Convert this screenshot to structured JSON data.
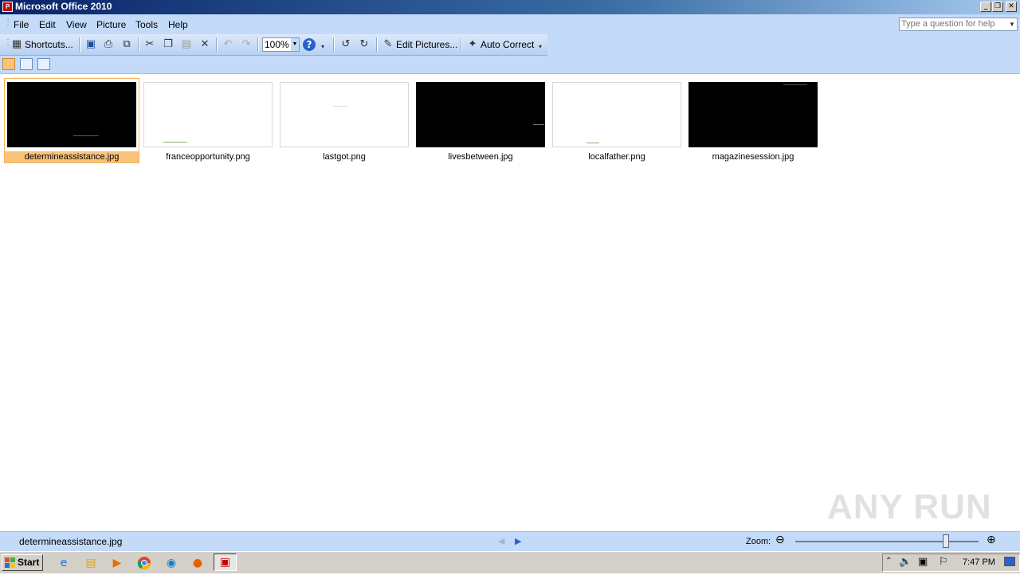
{
  "window": {
    "title": "Microsoft Office 2010",
    "controls": {
      "minimize": "_",
      "restore": "❐",
      "close": "✕"
    }
  },
  "menu": {
    "items": [
      "File",
      "Edit",
      "View",
      "Picture",
      "Tools",
      "Help"
    ],
    "help_placeholder": "Type a question for help"
  },
  "toolbar": {
    "shortcuts_label": "Shortcuts...",
    "zoom_value": "100%",
    "edit_pictures_label": "Edit Pictures...",
    "auto_correct_label": "Auto Correct"
  },
  "thumbnails": [
    {
      "filename": "determineassistance.jpg",
      "bg": "black",
      "selected": true
    },
    {
      "filename": "franceopportunity.png",
      "bg": "white",
      "selected": false
    },
    {
      "filename": "lastgot.png",
      "bg": "white",
      "selected": false
    },
    {
      "filename": "livesbetween.jpg",
      "bg": "black",
      "selected": false
    },
    {
      "filename": "localfather.png",
      "bg": "white",
      "selected": false
    },
    {
      "filename": "magazinesession.jpg",
      "bg": "black",
      "selected": false
    }
  ],
  "status": {
    "filename": "determineassistance.jpg",
    "zoom_label": "Zoom:",
    "zoom_level": 0.82
  },
  "taskbar": {
    "start_label": "Start",
    "clock": "7:47 PM"
  },
  "watermark": "ANY RUN",
  "colors": {
    "titlebar": "#0a246a",
    "bars": "#c3daf9",
    "selection": "#f9c47a",
    "taskbar": "#d4d0c8"
  }
}
